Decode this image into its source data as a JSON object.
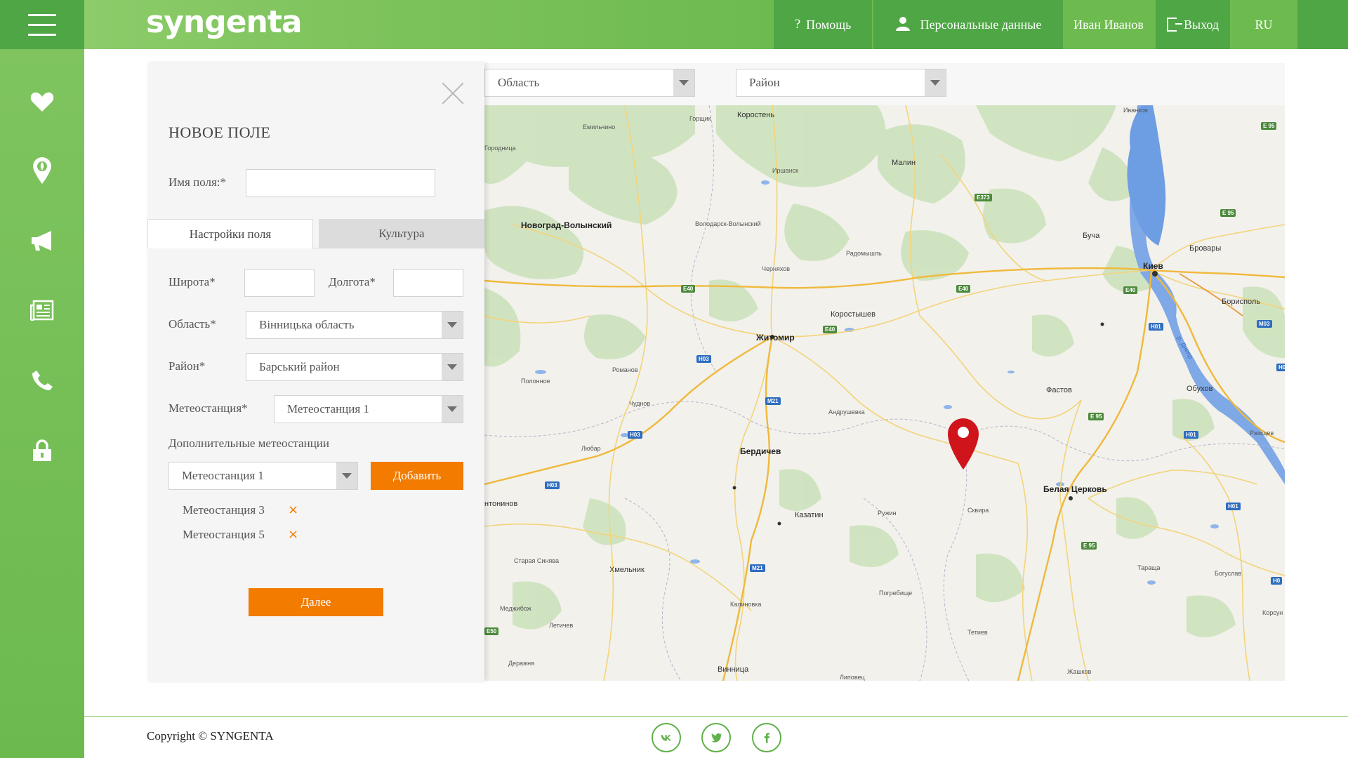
{
  "header": {
    "logo": "syngenta",
    "nav": {
      "help": "Помощь",
      "personal": "Персональные данные",
      "user": "Иван Иванов",
      "exit": "Выход",
      "lang": "RU"
    }
  },
  "sidebar": {
    "items": [
      {
        "icon": "heart-icon"
      },
      {
        "icon": "location-pin-icon"
      },
      {
        "icon": "megaphone-icon"
      },
      {
        "icon": "newspaper-icon"
      },
      {
        "icon": "phone-icon"
      },
      {
        "icon": "lock-icon"
      }
    ]
  },
  "form": {
    "title": "НОВОЕ ПОЛЕ",
    "name_label": "Имя поля:*",
    "name_value": "",
    "tabs": {
      "settings": "Настройки поля",
      "culture": "Культура"
    },
    "lat_label": "Широта*",
    "lat_value": "",
    "lon_label": "Долгота*",
    "lon_value": "",
    "region_label": "Область*",
    "region_value": "Вінницька область",
    "district_label": "Район*",
    "district_value": "Барський район",
    "station_label": "Метеостанция*",
    "station_value": "Метеостанция 1",
    "extra_label": "Дополнительные метеостанции",
    "extra_select_value": "Метеостанция 1",
    "add_button": "Добавить",
    "extra_stations": [
      "Метеостанция 3",
      "Метеостанция 5"
    ],
    "remove_symbol": "×",
    "next_button": "Далее"
  },
  "map": {
    "filter_region": "Область",
    "filter_district": "Район",
    "cities": {
      "korosten": "Коростень",
      "malin": "Малин",
      "ivankov": "Иванков",
      "novograd": "Новоград-Волынский",
      "zhitomir": "Житомир",
      "korostyshev": "Коростышев",
      "berdichev": "Бердичев",
      "kazatin": "Казатин",
      "kiev": "Киев",
      "bucha": "Буча",
      "brovary": "Бровары",
      "borispol": "Борисполь",
      "fastov": "Фастов",
      "obukhov": "Обухов",
      "belaya": "Белая Церковь",
      "skvira": "Сквира",
      "tetiev": "Тетиев",
      "khmelnik": "Хмельник",
      "vinnitsa": "Винница",
      "radomyshl": "Радомышль",
      "chernyakhov": "Черняхов",
      "volodarsk": "Володарск-Волынский",
      "irshansk": "Иршанск",
      "emilchino": "Емильчино",
      "gorshchik": "Горщик",
      "romanov": "Романов",
      "polonnoe": "Полонное",
      "chudnov": "Чуднов",
      "lyubar": "Любар",
      "andrushevka": "Андрушевка",
      "ruzhin": "Ружин",
      "pogrebishche": "Погребище",
      "kalinovka": "Калиновка",
      "staraya": "Старая Синява",
      "medzhibozh": "Меджибож",
      "letichev": "Летичев",
      "derazhnya": "Деражня",
      "tarashcha": "Тараща",
      "boguslav": "Богуслав",
      "zhashkov": "Жашков",
      "rzhishchev": "Ржищев",
      "gorodnitsa": "Городница",
      "antoninov": "нтонинов",
      "lipovets": "Липовец",
      "korsun": "Корсун"
    },
    "roads": {
      "e40a": "E40",
      "e40b": "E40",
      "e40c": "E40",
      "e40d": "E40",
      "e373": "E373",
      "e95a": "E 95",
      "e95b": "E 95",
      "e95c": "E 95",
      "e95d": "E 95",
      "m21a": "M21",
      "m21b": "M21",
      "m03": "M03",
      "h03a": "H03",
      "h03b": "H03",
      "h03c": "H03",
      "h01a": "H01",
      "h01b": "H01",
      "h01c": "H01",
      "e50": "E50",
      "h0": "H0",
      "h0b": "H0"
    },
    "river": "р. Днепр"
  },
  "footer": {
    "copyright": "Copyright © SYNGENTA",
    "social": [
      "vk-icon",
      "twitter-icon",
      "facebook-icon"
    ]
  },
  "colors": {
    "brand_green": "#6dbb4f",
    "dark_green": "#4fa645",
    "accent_orange": "#f27b00",
    "pin_red": "#d0141b"
  }
}
